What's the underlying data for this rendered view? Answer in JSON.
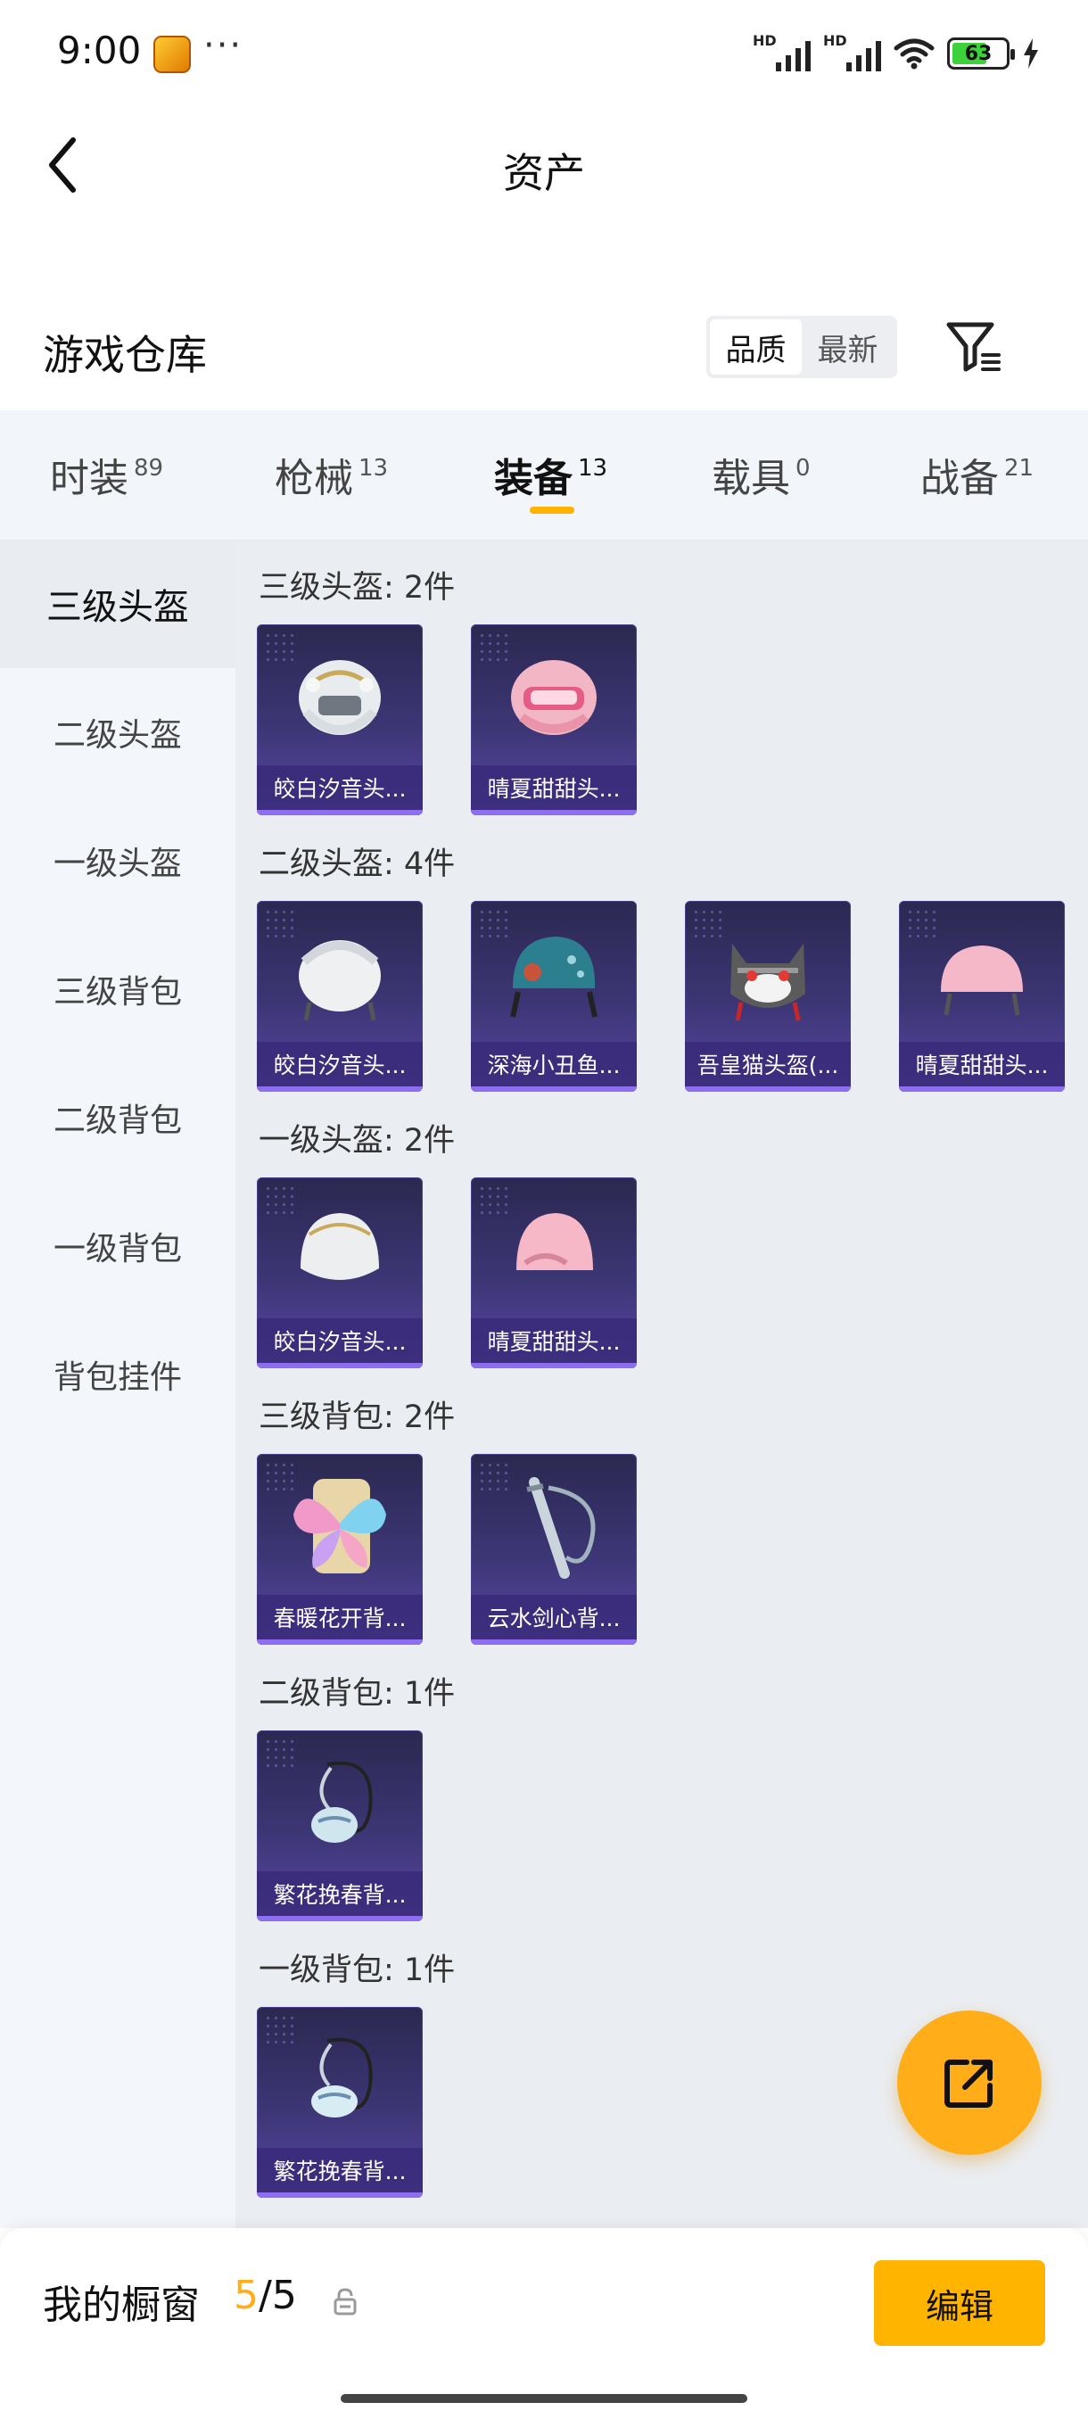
{
  "status_bar": {
    "time": "9:00",
    "more": "···",
    "battery": "63",
    "signal_label": "HD"
  },
  "header": {
    "title": "资产",
    "back_icon": "chevron-left-icon"
  },
  "warehouse": {
    "title": "游戏仓库",
    "sort_options": [
      "品质",
      "最新"
    ],
    "sort_selected": "品质",
    "filter_icon": "filter-list-icon"
  },
  "tabs": [
    {
      "label": "时装",
      "count": "89"
    },
    {
      "label": "枪械",
      "count": "13"
    },
    {
      "label": "装备",
      "count": "13",
      "active": true
    },
    {
      "label": "载具",
      "count": "0"
    },
    {
      "label": "战备",
      "count": "21"
    }
  ],
  "sidebar": [
    "三级头盔",
    "二级头盔",
    "一级头盔",
    "三级背包",
    "二级背包",
    "一级背包",
    "背包挂件"
  ],
  "sidebar_active": "三级头盔",
  "sections": [
    {
      "title": "三级头盔: 2件",
      "items": [
        "皎白汐音头...",
        "晴夏甜甜头..."
      ]
    },
    {
      "title": "二级头盔: 4件",
      "items": [
        "皎白汐音头...",
        "深海小丑鱼...",
        "吾皇猫头盔(...",
        "晴夏甜甜头..."
      ]
    },
    {
      "title": "一级头盔: 2件",
      "items": [
        "皎白汐音头...",
        "晴夏甜甜头..."
      ]
    },
    {
      "title": "三级背包: 2件",
      "items": [
        "春暖花开背...",
        "云水剑心背..."
      ]
    },
    {
      "title": "二级背包: 1件",
      "items": [
        "繁花挽春背..."
      ]
    },
    {
      "title": "一级背包: 1件",
      "items": [
        "繁花挽春背..."
      ]
    }
  ],
  "fab_icon": "share-out-icon",
  "showcase": {
    "title": "我的橱窗",
    "used": "5",
    "separator": "/",
    "total": "5",
    "lock_icon": "lock-icon",
    "edit_label": "编辑"
  },
  "colors": {
    "accent": "#ffb400",
    "card_bg": "#3d3676",
    "card_bar": "#8d6ef0",
    "sidebar_bg": "#f3f6fa",
    "content_bg": "#eaedf1"
  }
}
